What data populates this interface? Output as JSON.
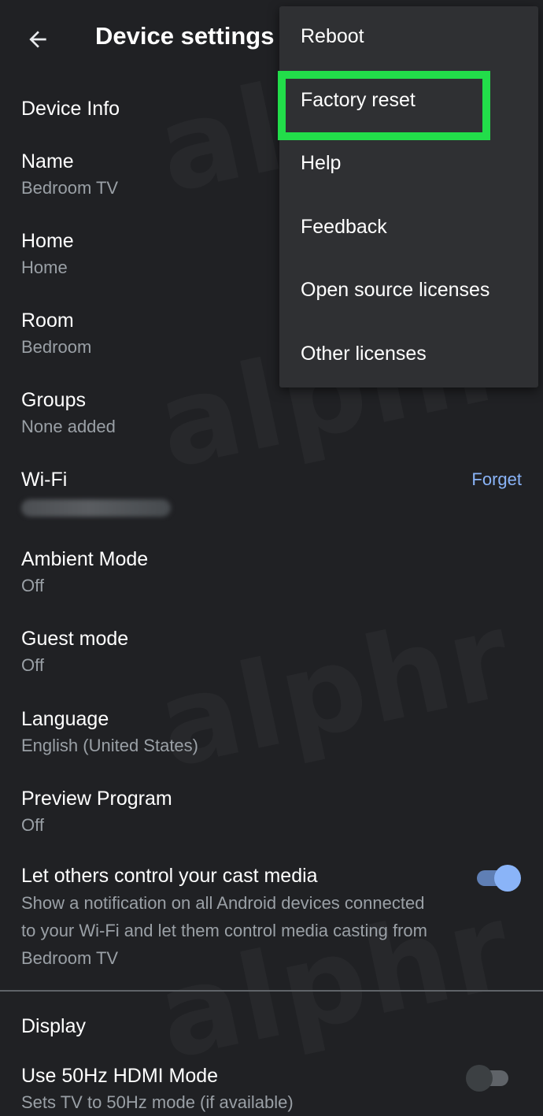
{
  "header": {
    "title": "Device settings",
    "back_icon": "arrow-back-icon"
  },
  "device_info": {
    "section_title": "Device Info",
    "items": [
      {
        "label": "Name",
        "value": "Bedroom TV"
      },
      {
        "label": "Home",
        "value": "Home"
      },
      {
        "label": "Room",
        "value": "Bedroom"
      },
      {
        "label": "Groups",
        "value": "None added"
      },
      {
        "label": "Wi-Fi",
        "value": "",
        "action": "Forget"
      },
      {
        "label": "Ambient Mode",
        "value": "Off"
      },
      {
        "label": "Guest mode",
        "value": "Off"
      },
      {
        "label": "Language",
        "value": "English (United States)"
      },
      {
        "label": "Preview Program",
        "value": "Off"
      }
    ],
    "cast_control": {
      "label": "Let others control your cast media",
      "description_lines": [
        "Show a notification on all Android devices connected",
        "to your Wi-Fi and let them control media casting from",
        "Bedroom TV"
      ],
      "enabled": true
    }
  },
  "display": {
    "section_title": "Display",
    "hdmi": {
      "label": "Use 50Hz HDMI Mode",
      "value": "Sets TV to 50Hz mode (if available)",
      "enabled": false
    }
  },
  "overflow_menu": {
    "items": [
      "Reboot",
      "Factory reset",
      "Help",
      "Feedback",
      "Open source licenses",
      "Other licenses"
    ],
    "highlighted": "Factory reset",
    "highlight_color": "#22dd4a"
  },
  "watermark": "alphr",
  "colors": {
    "background": "#202124",
    "menu_background": "#2f3033",
    "accent": "#8ab4f8",
    "secondary_text": "#9aa0a6"
  }
}
